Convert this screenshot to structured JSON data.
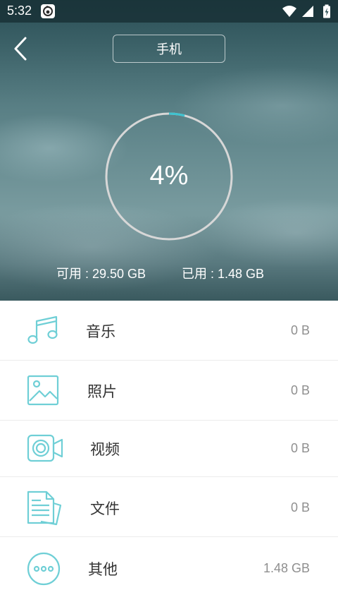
{
  "status_bar": {
    "time": "5:32",
    "icons": [
      "app-notification-icon",
      "wifi-icon",
      "signal-icon",
      "battery-charging-icon"
    ]
  },
  "header": {
    "title": "手机",
    "back_icon": "chevron-left-icon"
  },
  "usage": {
    "percent_text": "4%",
    "percent_value": 4,
    "available_text": "可用 : 29.50 GB",
    "used_text": "已用 : 1.48 GB",
    "ring_color": "#d7d7d7",
    "progress_color": "#3ec3d0"
  },
  "categories": [
    {
      "label": "音乐",
      "size": "0 B",
      "icon": "music-note-icon"
    },
    {
      "label": "照片",
      "size": "0 B",
      "icon": "image-icon"
    },
    {
      "label": "视频",
      "size": "0 B",
      "icon": "video-camera-icon"
    },
    {
      "label": "文件",
      "size": "0 B",
      "icon": "document-icon"
    },
    {
      "label": "其他",
      "size": "1.48 GB",
      "icon": "more-dots-icon"
    }
  ],
  "colors": {
    "icon_accent": "#6fcfd6",
    "divider": "#ececec",
    "label_text": "#333333",
    "size_text": "#8f8f8f"
  }
}
